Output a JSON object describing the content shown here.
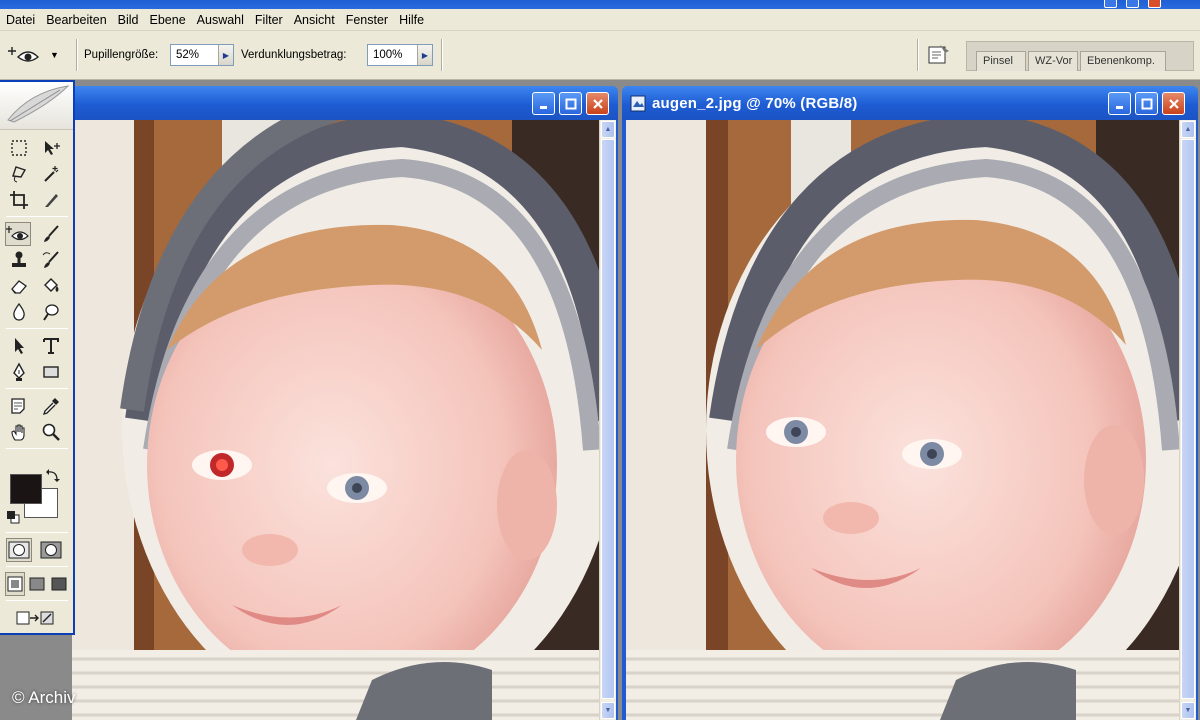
{
  "menu": {
    "items": [
      "Datei",
      "Bearbeiten",
      "Bild",
      "Ebene",
      "Auswahl",
      "Filter",
      "Ansicht",
      "Fenster",
      "Hilfe"
    ]
  },
  "options": {
    "pupil_label": "Pupillengröße:",
    "pupil_value": "52%",
    "darken_label": "Verdunklungsbetrag:",
    "darken_value": "100%"
  },
  "palette_well": {
    "tabs": [
      "Pinsel",
      "WZ-Vor",
      "Ebenenkomp."
    ]
  },
  "windows": {
    "left": {
      "title": ""
    },
    "right": {
      "title": "augen_2.jpg @ 70% (RGB/8)"
    }
  },
  "colors": {
    "foreground": "#1a1415",
    "background": "#ffffff",
    "titlebar": "#1e5cd3"
  },
  "icons": {
    "active_tool": "red-eye-tool-icon"
  },
  "watermark": {
    "text": "© Archiv"
  }
}
